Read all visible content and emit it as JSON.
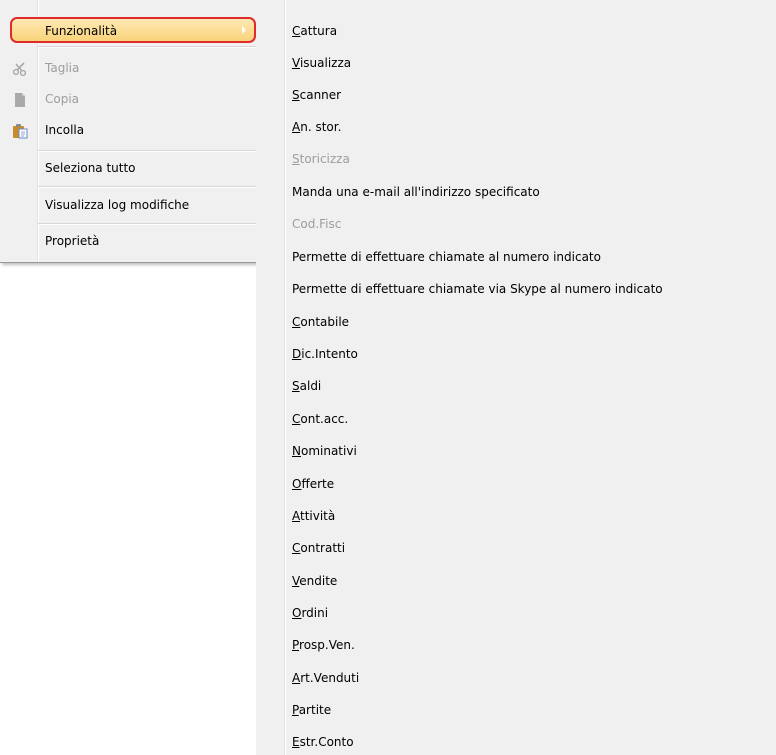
{
  "context_menu": {
    "items": [
      {
        "label": "Funzionalità",
        "state": "highlighted",
        "has_submenu": true
      },
      {
        "label": "Taglia",
        "state": "disabled",
        "icon": "scissors-icon"
      },
      {
        "label": "Copia",
        "state": "disabled",
        "icon": "copy-icon"
      },
      {
        "label": "Incolla",
        "state": "enabled",
        "icon": "paste-icon"
      },
      {
        "label": "Seleziona tutto",
        "state": "enabled"
      },
      {
        "label": "Visualizza log modifiche",
        "state": "enabled"
      },
      {
        "label": "Proprietà",
        "state": "enabled"
      }
    ]
  },
  "submenu": {
    "items": [
      {
        "first": "C",
        "rest": "attura",
        "disabled": false
      },
      {
        "first": "V",
        "rest": "isualizza",
        "disabled": false
      },
      {
        "first": "S",
        "rest": "canner",
        "disabled": false
      },
      {
        "first": "A",
        "rest": "n. stor.",
        "disabled": false
      },
      {
        "first": "S",
        "rest": "toricizza",
        "disabled": true
      },
      {
        "label": "Manda una e-mail all'indirizzo specificato",
        "disabled": false
      },
      {
        "label": "Cod.Fisc",
        "disabled": true
      },
      {
        "label": "Permette di effettuare chiamate al numero indicato",
        "disabled": false
      },
      {
        "label": "Permette di effettuare chiamate via Skype al numero indicato",
        "disabled": false
      },
      {
        "first": "C",
        "rest": "ontabile",
        "disabled": false
      },
      {
        "first": "D",
        "rest": "ic.Intento",
        "disabled": false
      },
      {
        "first": "S",
        "rest": "aldi",
        "disabled": false
      },
      {
        "first": "C",
        "rest": "ont.acc.",
        "disabled": false
      },
      {
        "first": "N",
        "rest": "ominativi",
        "disabled": false
      },
      {
        "first": "O",
        "rest": "fferte",
        "disabled": false
      },
      {
        "first": "A",
        "rest": "ttività",
        "disabled": false
      },
      {
        "first": "C",
        "rest": "ontratti",
        "disabled": false
      },
      {
        "first": "V",
        "rest": "endite",
        "disabled": false
      },
      {
        "first": "O",
        "rest": "rdini",
        "disabled": false
      },
      {
        "first": "P",
        "rest": "rosp.Ven.",
        "disabled": false
      },
      {
        "first": "A",
        "rest": "rt.Venduti",
        "disabled": false
      },
      {
        "first": "P",
        "rest": "artite",
        "disabled": false
      },
      {
        "first": "E",
        "rest": "str.Conto",
        "disabled": false
      }
    ]
  },
  "colors": {
    "highlight_border": "#e02b2b",
    "highlight_fill": "#f9d37a",
    "disabled_text": "#9d9d9d",
    "menu_bg": "#f0f0f0"
  }
}
